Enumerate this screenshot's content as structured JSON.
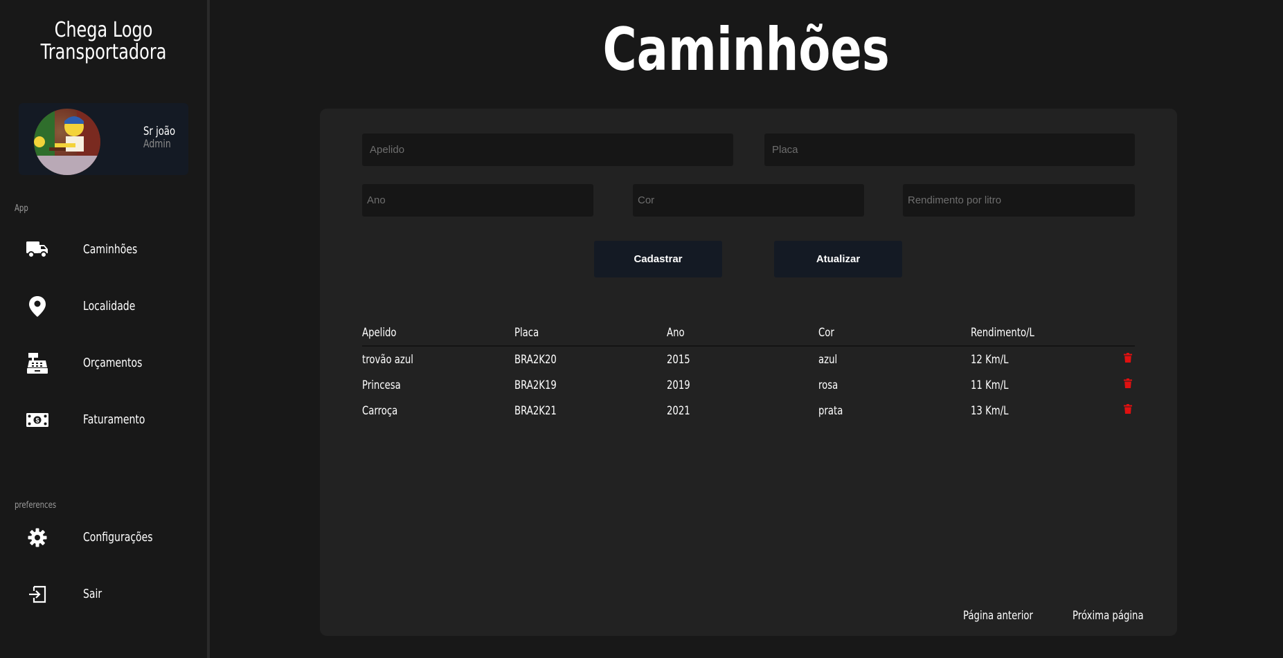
{
  "brand": {
    "line1": "Chega Logo",
    "line2": "Transportadora"
  },
  "profile": {
    "name": "Sr joão",
    "role": "Admin"
  },
  "sections": {
    "app": "App",
    "preferences": "preferences"
  },
  "nav": {
    "items": [
      {
        "label": "Caminhões",
        "icon": "truck-icon"
      },
      {
        "label": "Localidade",
        "icon": "location-pin-icon"
      },
      {
        "label": "Orçamentos",
        "icon": "cash-register-icon"
      },
      {
        "label": "Faturamento",
        "icon": "money-bill-icon"
      }
    ],
    "prefs": [
      {
        "label": "Configurações",
        "icon": "gear-icon"
      },
      {
        "label": "Sair",
        "icon": "logout-icon"
      }
    ]
  },
  "page": {
    "title": "Caminhões"
  },
  "form": {
    "apelido_placeholder": "Apelido",
    "placa_placeholder": "Placa",
    "ano_placeholder": "Ano",
    "cor_placeholder": "Cor",
    "rendimento_placeholder": "Rendimento por litro",
    "cadastrar_label": "Cadastrar",
    "atualizar_label": "Atualizar"
  },
  "table": {
    "headers": [
      "Apelido",
      "Placa",
      "Ano",
      "Cor",
      "Rendimento/L"
    ],
    "rows": [
      [
        "trovão azul",
        "BRA2K20",
        "2015",
        "azul",
        "12 Km/L"
      ],
      [
        "Princesa",
        "BRA2K19",
        "2019",
        "rosa",
        "11 Km/L"
      ],
      [
        "Carroça",
        "BRA2K21",
        "2021",
        "prata",
        "13 Km/L"
      ]
    ]
  },
  "pagination": {
    "prev": "Página anterior",
    "next": "Próxima página"
  },
  "colors": {
    "background": "#181818",
    "card": "#222222",
    "button": "#141a24",
    "delete": "#e01010"
  }
}
